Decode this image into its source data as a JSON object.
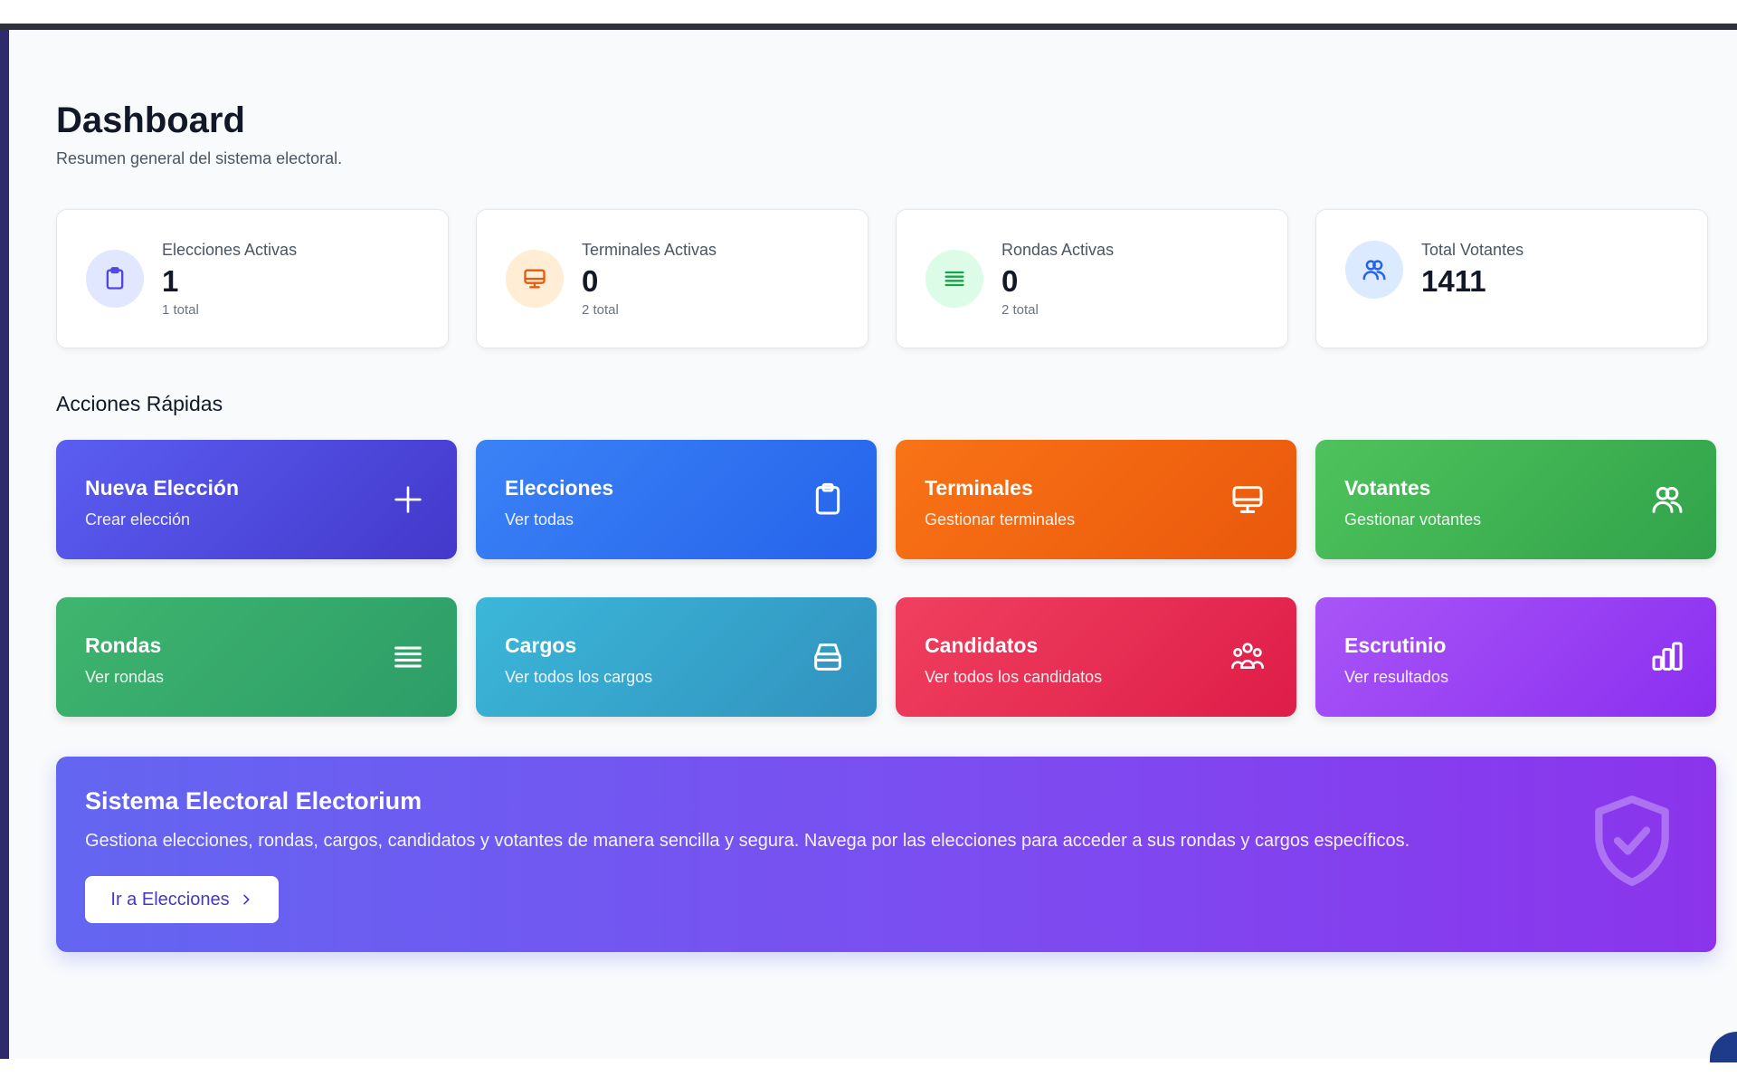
{
  "header": {
    "title": "Dashboard",
    "subtitle": "Resumen general del sistema electoral."
  },
  "stats": [
    {
      "label": "Elecciones Activas",
      "value": "1",
      "sub": "1 total",
      "icon": "clipboard-icon",
      "color": "#4f46e5",
      "bg": "#e0e7ff"
    },
    {
      "label": "Terminales Activas",
      "value": "0",
      "sub": "2 total",
      "icon": "monitor-icon",
      "color": "#ea580c",
      "bg": "#ffedd5"
    },
    {
      "label": "Rondas Activas",
      "value": "0",
      "sub": "2 total",
      "icon": "list-icon",
      "color": "#16a34a",
      "bg": "#dcfce7"
    },
    {
      "label": "Total Votantes",
      "value": "1411",
      "sub": "",
      "icon": "users-icon",
      "color": "#2563eb",
      "bg": "#dbeafe"
    }
  ],
  "quick_actions": {
    "title": "Acciones Rápidas",
    "items": [
      {
        "title": "Nueva Elección",
        "sub": "Crear elección",
        "icon": "plus-icon"
      },
      {
        "title": "Elecciones",
        "sub": "Ver todas",
        "icon": "clipboard-icon"
      },
      {
        "title": "Terminales",
        "sub": "Gestionar terminales",
        "icon": "monitor-icon"
      },
      {
        "title": "Votantes",
        "sub": "Gestionar votantes",
        "icon": "users-icon"
      },
      {
        "title": "Rondas",
        "sub": "Ver rondas",
        "icon": "list-icon"
      },
      {
        "title": "Cargos",
        "sub": "Ver todos los cargos",
        "icon": "box-icon"
      },
      {
        "title": "Candidatos",
        "sub": "Ver todos los candidatos",
        "icon": "group-icon"
      },
      {
        "title": "Escrutinio",
        "sub": "Ver resultados",
        "icon": "bar-chart-icon"
      }
    ]
  },
  "banner": {
    "title": "Sistema Electoral Electorium",
    "description": "Gestiona elecciones, rondas, cargos, candidatos y votantes de manera sencilla y segura. Navega por las elecciones para acceder a sus rondas y cargos específicos.",
    "button_label": "Ir a Elecciones",
    "icon": "shield-check-icon"
  }
}
